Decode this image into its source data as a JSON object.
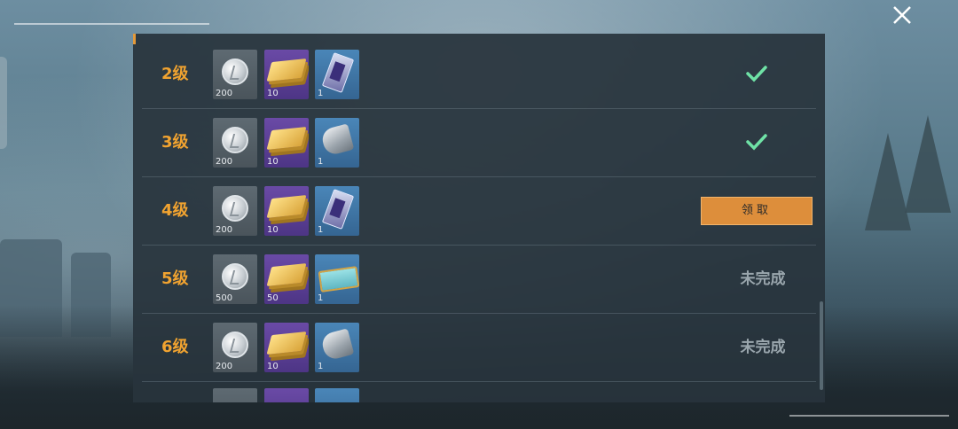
{
  "rows": [
    {
      "level": "2级",
      "items": [
        {
          "icon": "silver-coin-icon",
          "count": "200"
        },
        {
          "icon": "gold-tickets-icon",
          "count": "10"
        },
        {
          "icon": "card-icon",
          "count": "1"
        }
      ],
      "status": "done"
    },
    {
      "level": "3级",
      "items": [
        {
          "icon": "silver-coin-icon",
          "count": "200"
        },
        {
          "icon": "gold-tickets-icon",
          "count": "10"
        },
        {
          "icon": "armor-plate-icon",
          "count": "1"
        }
      ],
      "status": "done"
    },
    {
      "level": "4级",
      "items": [
        {
          "icon": "silver-coin-icon",
          "count": "200"
        },
        {
          "icon": "gold-tickets-icon",
          "count": "10"
        },
        {
          "icon": "card-icon",
          "count": "1"
        }
      ],
      "status": "claim",
      "claim_label": "领取"
    },
    {
      "level": "5级",
      "items": [
        {
          "icon": "silver-coin-icon",
          "count": "500"
        },
        {
          "icon": "gold-tickets-icon",
          "count": "50"
        },
        {
          "icon": "supply-crate-icon",
          "count": "1"
        }
      ],
      "status": "incomplete",
      "status_text": "未完成"
    },
    {
      "level": "6级",
      "items": [
        {
          "icon": "silver-coin-icon",
          "count": "200"
        },
        {
          "icon": "gold-tickets-icon",
          "count": "10"
        },
        {
          "icon": "armor-plate-icon",
          "count": "1"
        }
      ],
      "status": "incomplete",
      "status_text": "未完成"
    }
  ],
  "colors": {
    "level": "#f1a330",
    "check": "#6fe2a6",
    "claim_button": "#dd8e3b",
    "accent_corner": "#e49a3a"
  }
}
